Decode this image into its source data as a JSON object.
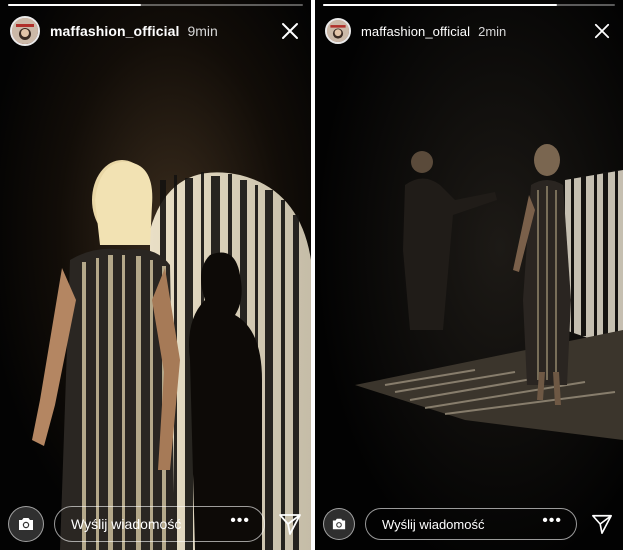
{
  "colors": {
    "accent": "#ffffff",
    "background": "#050505"
  },
  "stories": [
    {
      "username": "maffashion_official",
      "time": "9min",
      "progress": 0.45,
      "message_placeholder": "Wyślij wiadomość",
      "more_label": "•••",
      "icons": [
        "camera-icon",
        "send-icon",
        "close-icon",
        "more-icon"
      ]
    },
    {
      "username": "maffashion_official",
      "time": "2min",
      "progress": 0.8,
      "message_placeholder": "Wyślij wiadomość",
      "more_label": "•••",
      "icons": [
        "camera-icon",
        "send-icon",
        "close-icon",
        "more-icon"
      ]
    }
  ]
}
